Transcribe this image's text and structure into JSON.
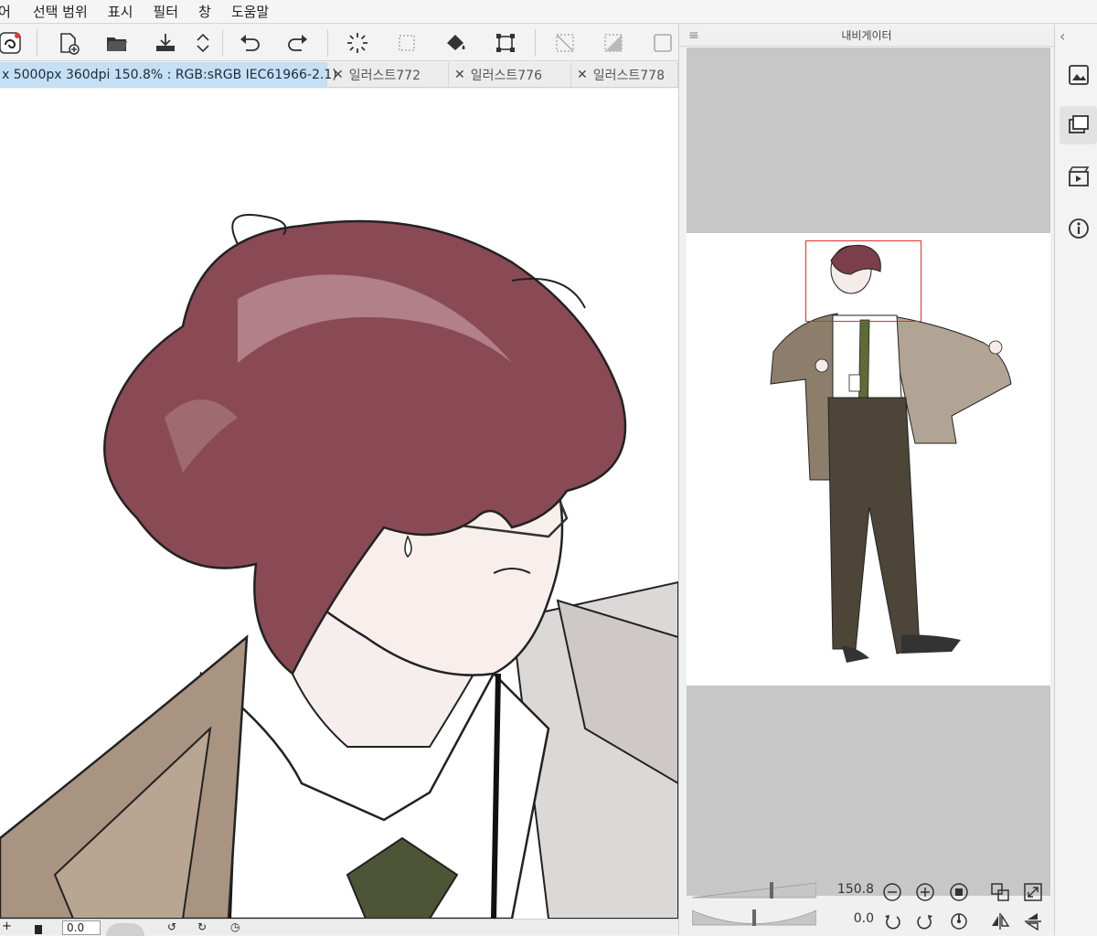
{
  "menu": {
    "items": [
      "어",
      "선택 범위",
      "표시",
      "필터",
      "창",
      "도움말"
    ]
  },
  "toolbar": {
    "icons": [
      "app-logo-icon",
      "new-file-icon",
      "open-folder-icon",
      "save-icon",
      "scroll-arrows-icon",
      "undo-icon",
      "redo-icon",
      "loading-spinner-icon",
      "clear-selection-icon",
      "fill-bucket-icon",
      "transform-icon",
      "deselect-icon",
      "invert-selection-icon",
      "show-selection-icon"
    ]
  },
  "tabs": {
    "active": " x 5000px 360dpi 150.8% : RGB:sRGB IEC61966-2.1)",
    "items": [
      "일러스트772",
      "일러스트776",
      "일러스트778"
    ]
  },
  "navigator": {
    "title": "내비게이터",
    "zoom_value": "150.8",
    "rotate_value": "0.0"
  },
  "statusbar": {
    "value": "0.0"
  },
  "colors": {
    "tab_active": "#c5dff4",
    "frame": "#e0302a",
    "panel_bg": "#f0f0f0",
    "nav_gray": "#c7c7c7"
  }
}
